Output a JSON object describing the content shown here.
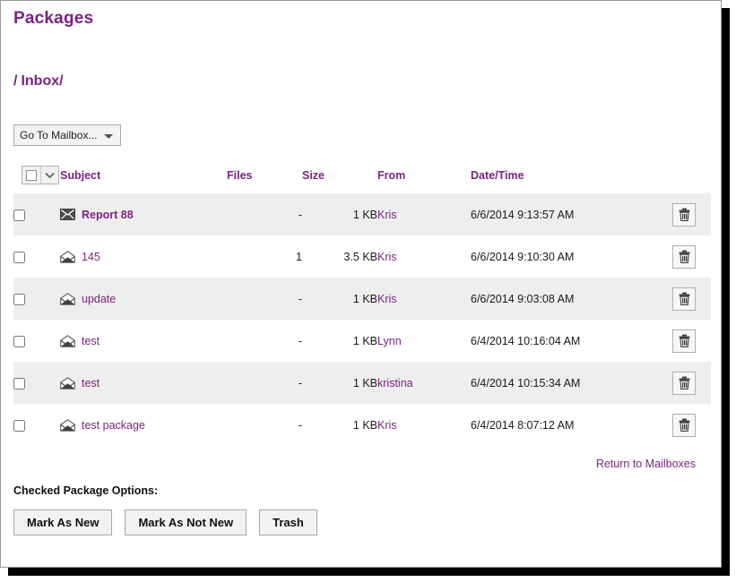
{
  "window": {
    "title": "Packages"
  },
  "breadcrumb": {
    "separator": "/",
    "current": "Inbox/"
  },
  "mailbox_select": {
    "selected": "Go To Mailbox...",
    "options": [
      "Go To Mailbox..."
    ]
  },
  "table": {
    "headers": {
      "subject": "Subject",
      "files": "Files",
      "size": "Size",
      "from": "From",
      "datetime": "Date/Time"
    },
    "rows": [
      {
        "subject": "Report 88",
        "unread": true,
        "icon": "envelope-closed-icon",
        "files": "-",
        "size": "1 KB",
        "from": "Kris",
        "datetime": "6/6/2014 9:13:57 AM"
      },
      {
        "subject": "145",
        "unread": false,
        "icon": "envelope-open-icon",
        "files": "1",
        "size": "3.5 KB",
        "from": "Kris",
        "datetime": "6/6/2014 9:10:30 AM"
      },
      {
        "subject": "update",
        "unread": false,
        "icon": "envelope-open-icon",
        "files": "-",
        "size": "1 KB",
        "from": "Kris",
        "datetime": "6/6/2014 9:03:08 AM"
      },
      {
        "subject": "test",
        "unread": false,
        "icon": "envelope-open-icon",
        "files": "-",
        "size": "1 KB",
        "from": "Lynn",
        "datetime": "6/4/2014 10:16:04 AM"
      },
      {
        "subject": "test",
        "unread": false,
        "icon": "envelope-open-icon",
        "files": "-",
        "size": "1 KB",
        "from": "kristina",
        "datetime": "6/4/2014 10:15:34 AM"
      },
      {
        "subject": "test package",
        "unread": false,
        "icon": "envelope-open-icon",
        "files": "-",
        "size": "1 KB",
        "from": "Kris",
        "datetime": "6/4/2014 8:07:12 AM"
      }
    ]
  },
  "footer": {
    "return_link": "Return to Mailboxes",
    "options_label": "Checked Package Options:",
    "buttons": [
      {
        "label": "Mark As New",
        "name": "mark-as-new-button"
      },
      {
        "label": "Mark As Not New",
        "name": "mark-as-not-new-button"
      },
      {
        "label": "Trash",
        "name": "trash-button"
      }
    ]
  },
  "colors": {
    "accent_purple": "#7b2382",
    "row_alt": "#eeeeee",
    "row_norm": "#ffffff"
  }
}
